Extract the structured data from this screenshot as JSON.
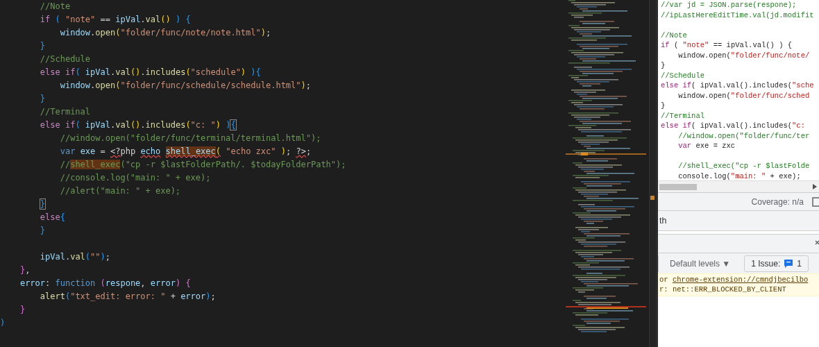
{
  "editor": {
    "lines": [
      [
        {
          "text": "        //Note",
          "kind": "comment"
        }
      ],
      [
        {
          "text": "        if ",
          "kind": "keyword"
        },
        {
          "text": "( ",
          "kind": "bracket-blue"
        },
        {
          "text": "\"note\"",
          "kind": "string"
        },
        {
          "text": " == ",
          "kind": "plain"
        },
        {
          "text": "ipVal",
          "kind": "variable"
        },
        {
          "text": ".",
          "kind": "plain"
        },
        {
          "text": "val",
          "kind": "function"
        },
        {
          "text": "() ",
          "kind": "bracket-gold"
        },
        {
          "text": ") ",
          "kind": "bracket-blue"
        },
        {
          "text": "{",
          "kind": "bracket-blue"
        }
      ],
      [
        {
          "text": "            window",
          "kind": "variable"
        },
        {
          "text": ".",
          "kind": "plain"
        },
        {
          "text": "open",
          "kind": "function"
        },
        {
          "text": "(",
          "kind": "bracket-gold"
        },
        {
          "text": "\"folder/func/note/note.html\"",
          "kind": "string"
        },
        {
          "text": ")",
          "kind": "bracket-gold"
        },
        {
          "text": ";",
          "kind": "plain"
        }
      ],
      [
        {
          "text": "        }",
          "kind": "bracket-blue"
        }
      ],
      [
        {
          "text": "        //Schedule",
          "kind": "comment"
        }
      ],
      [
        {
          "text": "        else if",
          "kind": "keyword"
        },
        {
          "text": "( ",
          "kind": "bracket-blue"
        },
        {
          "text": "ipVal",
          "kind": "variable"
        },
        {
          "text": ".",
          "kind": "plain"
        },
        {
          "text": "val",
          "kind": "function"
        },
        {
          "text": "()",
          "kind": "bracket-gold"
        },
        {
          "text": ".",
          "kind": "plain"
        },
        {
          "text": "includes",
          "kind": "function"
        },
        {
          "text": "(",
          "kind": "bracket-gold"
        },
        {
          "text": "\"schedule\"",
          "kind": "string"
        },
        {
          "text": ") ",
          "kind": "bracket-gold"
        },
        {
          "text": ")",
          "kind": "bracket-blue"
        },
        {
          "text": "{",
          "kind": "bracket-blue"
        }
      ],
      [
        {
          "text": "            window",
          "kind": "variable"
        },
        {
          "text": ".",
          "kind": "plain"
        },
        {
          "text": "open",
          "kind": "function"
        },
        {
          "text": "(",
          "kind": "bracket-gold"
        },
        {
          "text": "\"folder/func/schedule/schedule.html\"",
          "kind": "string"
        },
        {
          "text": ")",
          "kind": "bracket-gold"
        },
        {
          "text": ";",
          "kind": "plain"
        }
      ],
      [
        {
          "text": "        }",
          "kind": "bracket-blue"
        }
      ],
      [
        {
          "text": "        //Terminal",
          "kind": "comment"
        }
      ],
      [
        {
          "text": "        else if",
          "kind": "keyword"
        },
        {
          "text": "( ",
          "kind": "bracket-blue"
        },
        {
          "text": "ipVal",
          "kind": "variable"
        },
        {
          "text": ".",
          "kind": "plain"
        },
        {
          "text": "val",
          "kind": "function"
        },
        {
          "text": "()",
          "kind": "bracket-gold"
        },
        {
          "text": ".",
          "kind": "plain"
        },
        {
          "text": "includes",
          "kind": "function"
        },
        {
          "text": "(",
          "kind": "bracket-gold"
        },
        {
          "text": "\"c: \"",
          "kind": "string"
        },
        {
          "text": ") ",
          "kind": "bracket-gold"
        },
        {
          "text": ")",
          "kind": "bracket-blue"
        },
        {
          "text": "{",
          "kind": "bracket-blue",
          "boxed": true
        }
      ],
      [
        {
          "text": "            //window.open(\"folder/func/terminal/terminal.html\");",
          "kind": "comment"
        }
      ],
      [
        {
          "text": "            var ",
          "kind": "storage"
        },
        {
          "text": "exe",
          "kind": "variable"
        },
        {
          "text": " = ",
          "kind": "plain"
        },
        {
          "text": "<?",
          "kind": "plain",
          "squiggle": true
        },
        {
          "text": "php ",
          "kind": "plain"
        },
        {
          "text": "echo",
          "kind": "variable",
          "squiggle": true
        },
        {
          "text": " shell_exec",
          "kind": "variable",
          "highlighted": true,
          "squiggle": true
        },
        {
          "text": "(",
          "kind": "bracket-gold",
          "squiggle": true
        },
        {
          "text": " \"echo zxc\" ",
          "kind": "string"
        },
        {
          "text": ")",
          "kind": "bracket-gold"
        },
        {
          "text": "; ",
          "kind": "plain"
        },
        {
          "text": "?>",
          "kind": "plain",
          "squiggle": true
        },
        {
          "text": ";",
          "kind": "plain"
        }
      ],
      [
        {
          "text": "            //",
          "kind": "comment"
        },
        {
          "text": "shell_exec",
          "kind": "comment",
          "highlighted": true
        },
        {
          "text": "(\"cp -r $lastFolderPath/. $todayFolderPath\");",
          "kind": "comment"
        }
      ],
      [
        {
          "text": "            //console.log(\"main: \" + exe);",
          "kind": "comment"
        }
      ],
      [
        {
          "text": "            //alert(\"main: \" + exe);",
          "kind": "comment"
        }
      ],
      [
        {
          "text": "        }",
          "kind": "bracket-blue",
          "boxed": true
        }
      ],
      [
        {
          "text": "        else",
          "kind": "keyword"
        },
        {
          "text": "{",
          "kind": "bracket-blue"
        }
      ],
      [
        {
          "text": "        }",
          "kind": "bracket-blue"
        }
      ],
      [
        {
          "kind": "blank"
        }
      ],
      [
        {
          "text": "        ipVal",
          "kind": "variable"
        },
        {
          "text": ".",
          "kind": "plain"
        },
        {
          "text": "val",
          "kind": "function"
        },
        {
          "text": "(",
          "kind": "bracket-blue"
        },
        {
          "text": "\"\"",
          "kind": "string"
        },
        {
          "text": ")",
          "kind": "bracket-blue"
        },
        {
          "text": ";",
          "kind": "plain"
        }
      ],
      [
        {
          "text": "    }",
          "kind": "bracket-purple"
        },
        {
          "text": ",",
          "kind": "plain"
        }
      ],
      [
        {
          "text": "    error",
          "kind": "variable"
        },
        {
          "text": ": ",
          "kind": "plain"
        },
        {
          "text": "function ",
          "kind": "storage"
        },
        {
          "text": "(",
          "kind": "bracket-purple"
        },
        {
          "text": "respone",
          "kind": "variable"
        },
        {
          "text": ", ",
          "kind": "plain"
        },
        {
          "text": "error",
          "kind": "variable"
        },
        {
          "text": ") ",
          "kind": "bracket-purple"
        },
        {
          "text": "{",
          "kind": "bracket-purple"
        }
      ],
      [
        {
          "text": "        alert",
          "kind": "function"
        },
        {
          "text": "(",
          "kind": "bracket-blue"
        },
        {
          "text": "\"txt_edit: error: \"",
          "kind": "string"
        },
        {
          "text": " + ",
          "kind": "plain"
        },
        {
          "text": "error",
          "kind": "variable"
        },
        {
          "text": ")",
          "kind": "bracket-blue"
        },
        {
          "text": ";",
          "kind": "plain"
        }
      ],
      [
        {
          "text": "    }",
          "kind": "bracket-purple"
        }
      ],
      [
        {
          "text": ")",
          "kind": "bracket-blue"
        }
      ]
    ]
  },
  "devtools": {
    "source_lines": [
      [
        {
          "text": "//var jd = JSON.parse(respone);",
          "kind": "comment"
        }
      ],
      [
        {
          "text": "//ipLastHereEditTime.val(jd.modifit",
          "kind": "comment"
        }
      ],
      [
        {
          "kind": "blank"
        }
      ],
      [
        {
          "text": "//Note",
          "kind": "comment"
        }
      ],
      [
        {
          "text": "if",
          "kind": "keyword"
        },
        {
          "text": " ( ",
          "kind": "plain"
        },
        {
          "text": "\"note\"",
          "kind": "string"
        },
        {
          "text": " == ipVal.val() ) {",
          "kind": "plain"
        }
      ],
      [
        {
          "text": "    window.open(",
          "kind": "plain"
        },
        {
          "text": "\"folder/func/note/",
          "kind": "string"
        }
      ],
      [
        {
          "text": "}",
          "kind": "plain"
        }
      ],
      [
        {
          "text": "//Schedule",
          "kind": "comment"
        }
      ],
      [
        {
          "text": "else if",
          "kind": "keyword"
        },
        {
          "text": "( ipVal.val().includes(",
          "kind": "plain"
        },
        {
          "text": "\"sche",
          "kind": "string"
        }
      ],
      [
        {
          "text": "    window.open(",
          "kind": "plain"
        },
        {
          "text": "\"folder/func/sched",
          "kind": "string"
        }
      ],
      [
        {
          "text": "}",
          "kind": "plain"
        }
      ],
      [
        {
          "text": "//Terminal",
          "kind": "comment"
        }
      ],
      [
        {
          "text": "else if",
          "kind": "keyword"
        },
        {
          "text": "( ipVal.val().includes(",
          "kind": "plain"
        },
        {
          "text": "\"c:",
          "kind": "string"
        }
      ],
      [
        {
          "text": "    //window.open(\"folder/func/ter",
          "kind": "comment"
        }
      ],
      [
        {
          "text": "    var",
          "kind": "keyword"
        },
        {
          "text": " exe = zxc",
          "kind": "plain"
        }
      ],
      [
        {
          "kind": "blank"
        }
      ],
      [
        {
          "text": "    //shell_exec(\"cp -r $lastFolde",
          "kind": "comment"
        }
      ],
      [
        {
          "text": "    console.log(",
          "kind": "plain"
        },
        {
          "text": "\"main: \"",
          "kind": "string"
        },
        {
          "text": " + exe);",
          "kind": "plain"
        }
      ]
    ],
    "coverage": "Coverage: n/a",
    "panel_label": "th",
    "level_select": "Default levels ▼",
    "issues": {
      "label": "1 Issue:",
      "count": "1"
    },
    "messages": [
      [
        {
          "text": "or ",
          "kind": "plain"
        },
        {
          "text": "chrome-extension://cmndjbecilbo",
          "kind": "link"
        }
      ],
      [
        {
          "text": "r: net::ERR_BLOCKED_BY_CLIENT",
          "kind": "plain"
        }
      ]
    ]
  }
}
